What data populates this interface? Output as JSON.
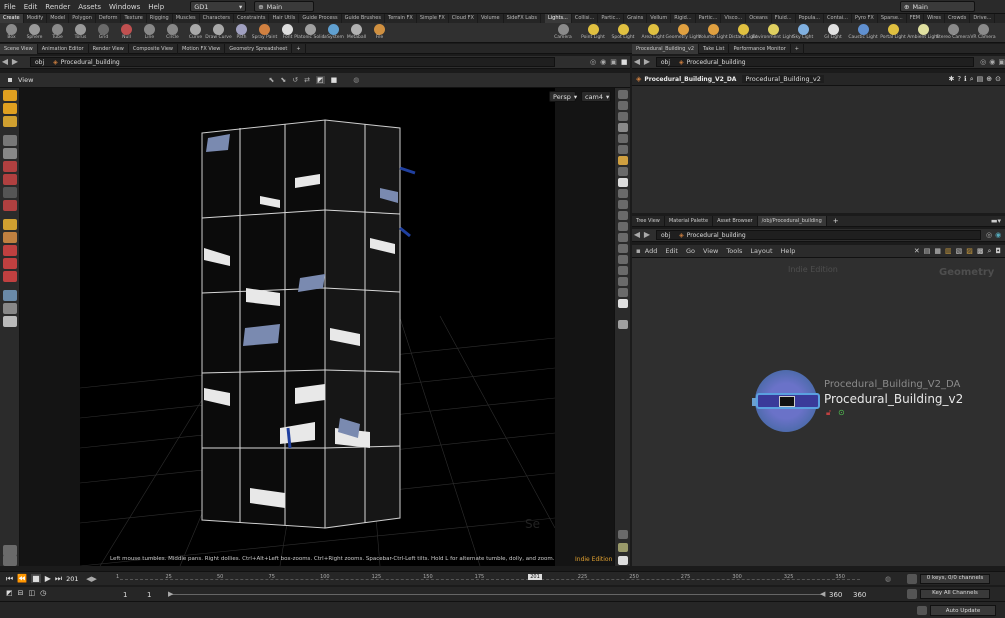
{
  "menubar": {
    "items": [
      "File",
      "Edit",
      "Render",
      "Assets",
      "Windows",
      "Help"
    ],
    "desktop": "GD1",
    "context": "Main",
    "right_context": "Main"
  },
  "shelf_tabs_left": [
    "Create",
    "Modify",
    "Model",
    "Polygon",
    "Deform",
    "Texture",
    "Rigging",
    "Muscles",
    "Characters",
    "Constraints",
    "Hair Utils",
    "Guide Process",
    "Guide Brushes",
    "Terrain FX",
    "Simple FX",
    "Cloud FX",
    "Volume",
    "SideFX Labs"
  ],
  "shelf_tabs_right": [
    "Lights...",
    "Collisi...",
    "Partic...",
    "Grains",
    "Vellum",
    "Rigid...",
    "Partic...",
    "Visco...",
    "Oceans",
    "Fluid...",
    "Popula...",
    "Contai...",
    "Pyro FX",
    "Sparse...",
    "FEM",
    "Wires",
    "Crowds",
    "Drive..."
  ],
  "tools_left": [
    {
      "label": "Box",
      "color": "#8a8a8a"
    },
    {
      "label": "Sphere",
      "color": "#9a9a9a"
    },
    {
      "label": "Tube",
      "color": "#8a8a8a"
    },
    {
      "label": "Torus",
      "color": "#9a9a9a"
    },
    {
      "label": "Grid",
      "color": "#6a6a6a"
    },
    {
      "label": "Null",
      "color": "#c05050"
    },
    {
      "label": "Line",
      "color": "#888"
    },
    {
      "label": "Circle",
      "color": "#888"
    },
    {
      "label": "Curve",
      "color": "#a8a8a8"
    },
    {
      "label": "Draw Curve",
      "color": "#a8a8a8"
    },
    {
      "label": "Path",
      "color": "#a0a0c0"
    },
    {
      "label": "Spray Paint",
      "color": "#d08040"
    },
    {
      "label": "Font",
      "color": "#ddd"
    },
    {
      "label": "Platonic Solids",
      "color": "#a0a0a0"
    },
    {
      "label": "L-System",
      "color": "#60a0d0"
    },
    {
      "label": "Metaball",
      "color": "#b0b0b0"
    },
    {
      "label": "File",
      "color": "#d09040"
    }
  ],
  "tools_right": [
    {
      "label": "Camera",
      "color": "#8a8a8a"
    },
    {
      "label": "Point Light",
      "color": "#e0c040"
    },
    {
      "label": "Spot Light",
      "color": "#e0c040"
    },
    {
      "label": "Area Light",
      "color": "#e0c040"
    },
    {
      "label": "Geometry Light",
      "color": "#e0a040"
    },
    {
      "label": "Volume Light",
      "color": "#e0a040"
    },
    {
      "label": "Distant Light",
      "color": "#e0c040"
    },
    {
      "label": "Environment Light",
      "color": "#e0d060"
    },
    {
      "label": "Sky Light",
      "color": "#80b0e0"
    },
    {
      "label": "GI Light",
      "color": "#e0e0e0"
    },
    {
      "label": "Caustic Light",
      "color": "#6090d0"
    },
    {
      "label": "Portal Light",
      "color": "#e0c040"
    },
    {
      "label": "Ambient Light",
      "color": "#e0e0a0"
    },
    {
      "label": "Stereo Camera",
      "color": "#8a8a8a"
    },
    {
      "label": "VR Camera",
      "color": "#8a8a8a"
    }
  ],
  "left_pane_tabs": [
    "Scene View",
    "Animation Editor",
    "Render View",
    "Composite View",
    "Motion FX View",
    "Geometry Spreadsheet"
  ],
  "right_pane_tabs": [
    "Procedural_Building_v2",
    "Take List",
    "Performance Monitor"
  ],
  "left_path": {
    "level": "obj",
    "node": "Procedural_building"
  },
  "right_path": {
    "level": "obj",
    "node": "Procedural_building"
  },
  "viewport": {
    "label": "View",
    "persp": "Persp",
    "cam": "cam4",
    "hint": "Left mouse tumbles. Middle pans. Right dollies. Ctrl+Alt+Left box-zooms. Ctrl+Right zooms. Spacebar-Ctrl-Left tilts. Hold L for alternate tumble, dolly, and zoom.",
    "edition": "Indie Edition"
  },
  "param": {
    "type": "Procedural_Building_V2_DA",
    "name": "Procedural_Building_v2"
  },
  "net_tabs": [
    "Tree View",
    "Material Palette",
    "Asset Browser",
    "/obj/Procedural_building"
  ],
  "net_path": {
    "level": "obj",
    "node": "Procedural_building"
  },
  "net_menu": [
    "Add",
    "Edit",
    "Go",
    "View",
    "Tools",
    "Layout",
    "Help"
  ],
  "net": {
    "edition": "Indie Edition",
    "context": "Geometry",
    "node_type": "Procedural_Building_V2_DA",
    "node_name": "Procedural_Building_v2"
  },
  "timeline": {
    "frame": "201",
    "ticks": [
      "1",
      "25",
      "50",
      "75",
      "100",
      "125",
      "150",
      "175",
      "201",
      "225",
      "250",
      "275",
      "300",
      "325",
      "350"
    ],
    "current_tick_index": 8,
    "start": "1",
    "start2": "1",
    "end": "360",
    "end2": "360",
    "keys": "0 keys, 0/0 channels",
    "key_all": "Key All Channels",
    "auto_update": "Auto Update"
  }
}
